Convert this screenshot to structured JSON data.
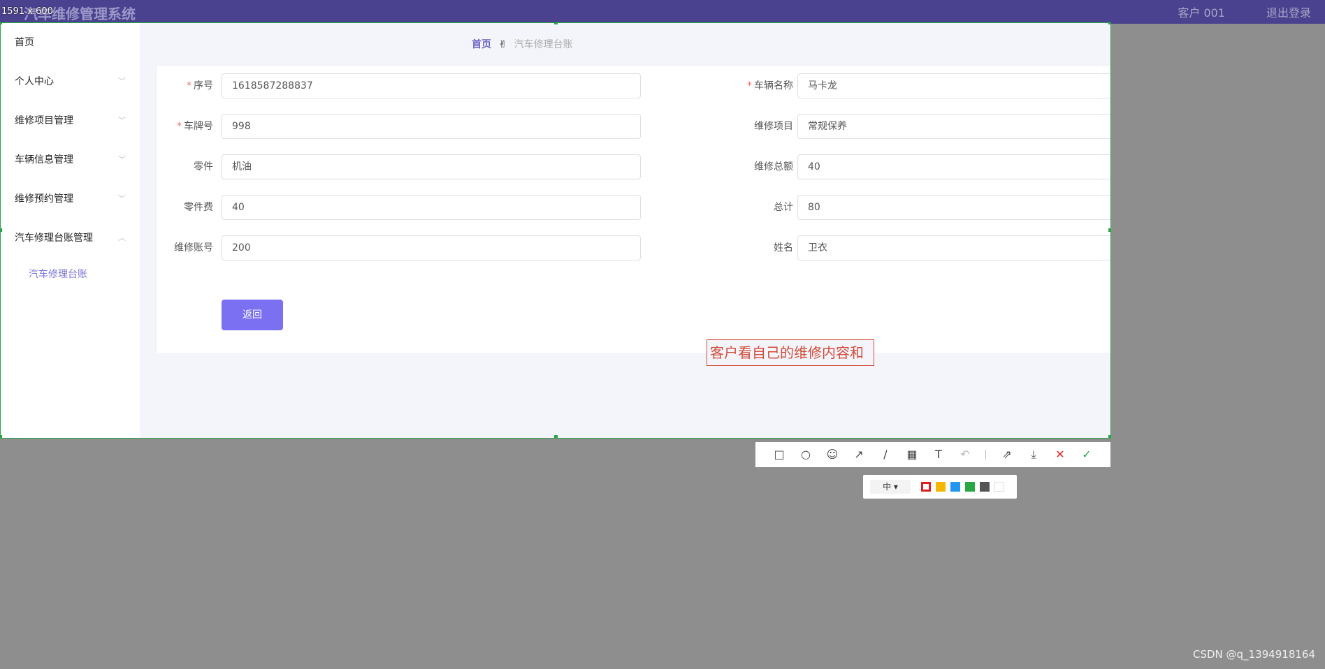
{
  "app": {
    "title": "汽车维修管理系统",
    "user": "客户 001",
    "logout": "退出登录"
  },
  "screenshot_tool": {
    "dimensions_label": "1591 x 600",
    "text_annotation": "客户看自己的维修内容和",
    "toolbar_icons": [
      "rectangle-icon",
      "circle-icon",
      "emoji-icon",
      "arrow-icon",
      "pen-icon",
      "mosaic-icon",
      "text-icon",
      "undo-icon",
      "share-icon",
      "download-icon",
      "close-icon",
      "confirm-icon"
    ],
    "size_option": "中",
    "colors": [
      "#e02020",
      "#f5b700",
      "#2196f3",
      "#28a745",
      "#555555",
      "#ffffff"
    ]
  },
  "sidebar": {
    "items": [
      {
        "label": "首页"
      },
      {
        "label": "个人中心"
      },
      {
        "label": "维修项目管理"
      },
      {
        "label": "车辆信息管理"
      },
      {
        "label": "维修预约管理"
      },
      {
        "label": "汽车修理台账管理"
      }
    ],
    "sub_item": "汽车修理台账"
  },
  "breadcrumb": {
    "home": "首页",
    "current": "汽车修理台账"
  },
  "form": {
    "left": [
      {
        "label": "序号",
        "value": "1618587288837",
        "required": true
      },
      {
        "label": "车牌号",
        "value": "998",
        "required": true
      },
      {
        "label": "零件",
        "value": "机油",
        "required": false
      },
      {
        "label": "零件费",
        "value": "40",
        "required": false
      },
      {
        "label": "维修账号",
        "value": "200",
        "required": false
      }
    ],
    "right": [
      {
        "label": "车辆名称",
        "value": "马卡龙",
        "required": true
      },
      {
        "label": "维修项目",
        "value": "常规保养",
        "required": false
      },
      {
        "label": "维修总额",
        "value": "40",
        "required": false
      },
      {
        "label": "总计",
        "value": "80",
        "required": false
      },
      {
        "label": "姓名",
        "value": "卫衣",
        "required": false
      }
    ],
    "back_button": "返回"
  },
  "watermark": "CSDN @q_1394918164"
}
